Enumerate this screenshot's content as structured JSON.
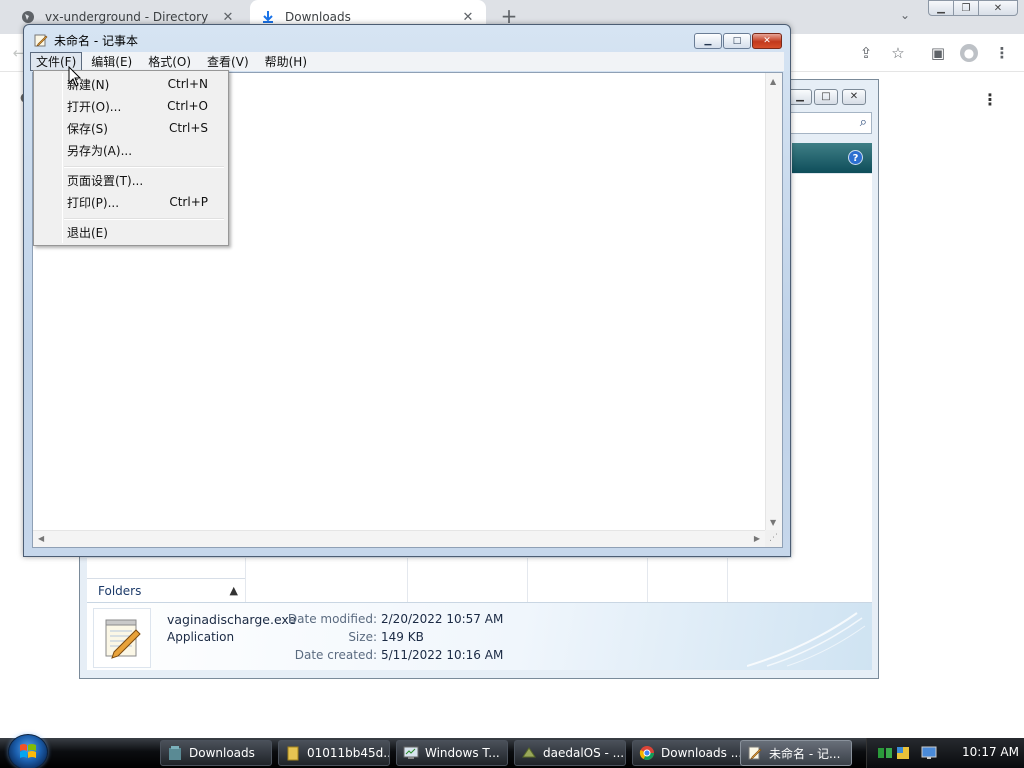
{
  "browser": {
    "tabs": [
      {
        "title": "vx-underground - Directory",
        "icon": "globe-icon"
      },
      {
        "title": "Downloads",
        "icon": "download-icon",
        "active": true
      }
    ]
  },
  "explorer": {
    "folders_label": "Folders",
    "details": {
      "file_name": "vaginadischarge.exe",
      "file_type": "Application",
      "date_modified_label": "Date modified:",
      "date_modified": "2/20/2022 10:57 AM",
      "size_label": "Size:",
      "size": "149 KB",
      "date_created_label": "Date created:",
      "date_created": "5/11/2022 10:16 AM"
    }
  },
  "notepad": {
    "title": "未命名 - 记事本",
    "menus": [
      "文件(F)",
      "编辑(E)",
      "格式(O)",
      "查看(V)",
      "帮助(H)"
    ],
    "file_menu": {
      "items": [
        {
          "label": "新建(N)",
          "shortcut": "Ctrl+N"
        },
        {
          "label": "打开(O)...",
          "shortcut": "Ctrl+O"
        },
        {
          "label": "保存(S)",
          "shortcut": "Ctrl+S"
        },
        {
          "label": "另存为(A)...",
          "shortcut": ""
        },
        {
          "label": "页面设置(T)...",
          "shortcut": ""
        },
        {
          "label": "打印(P)...",
          "shortcut": "Ctrl+P"
        },
        {
          "label": "退出(E)",
          "shortcut": ""
        }
      ]
    }
  },
  "taskbar": {
    "buttons": [
      {
        "label": "Downloads",
        "icon": "folder-icon"
      },
      {
        "label": "01011bb45d...",
        "icon": "folder-icon"
      },
      {
        "label": "Windows T...",
        "icon": "task-manager-icon"
      },
      {
        "label": "daedalOS - ...",
        "icon": "app-icon"
      },
      {
        "label": "Downloads ...",
        "icon": "chrome-icon"
      },
      {
        "label": "未命名 - 记...",
        "icon": "notepad-icon",
        "active": true
      }
    ],
    "clock": "10:17 AM"
  }
}
